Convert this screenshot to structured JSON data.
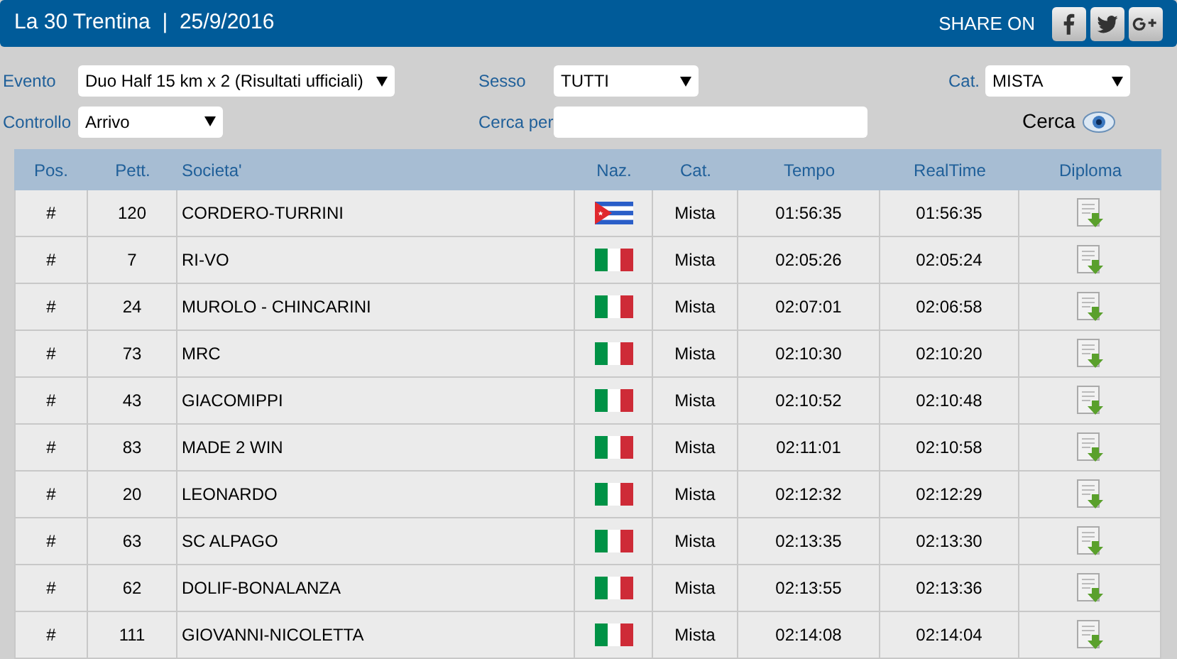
{
  "header": {
    "title": "La 30 Trentina  |  25/9/2016",
    "share_label": "SHARE ON",
    "share_buttons": [
      {
        "kind": "facebook"
      },
      {
        "kind": "twitter"
      },
      {
        "kind": "googleplus"
      }
    ]
  },
  "filters": {
    "evento": {
      "label": "Evento",
      "value": "Duo Half 15 km x 2 (Risultati ufficiali)"
    },
    "sesso": {
      "label": "Sesso",
      "value": "TUTTI"
    },
    "cat": {
      "label": "Cat.",
      "value": "MISTA"
    },
    "controllo": {
      "label": "Controllo",
      "value": "Arrivo"
    },
    "cerca_per": {
      "label": "Cerca per"
    },
    "search_button": "Cerca"
  },
  "table": {
    "columns": [
      "Pos.",
      "Pett.",
      "Societa'",
      "Naz.",
      "Cat.",
      "Tempo",
      "RealTime",
      "Diploma"
    ],
    "rows": [
      {
        "pos": "#",
        "pett": "120",
        "societa": "CORDERO-TURRINI",
        "naz": {
          "kind": "cuba"
        },
        "cat": "Mista",
        "tempo": "01:56:35",
        "realtime": "01:56:35"
      },
      {
        "pos": "#",
        "pett": "7",
        "societa": "RI-VO",
        "naz": {
          "kind": "italy"
        },
        "cat": "Mista",
        "tempo": "02:05:26",
        "realtime": "02:05:24"
      },
      {
        "pos": "#",
        "pett": "24",
        "societa": "MUROLO - CHINCARINI",
        "naz": {
          "kind": "italy"
        },
        "cat": "Mista",
        "tempo": "02:07:01",
        "realtime": "02:06:58"
      },
      {
        "pos": "#",
        "pett": "73",
        "societa": "MRC",
        "naz": {
          "kind": "italy"
        },
        "cat": "Mista",
        "tempo": "02:10:30",
        "realtime": "02:10:20"
      },
      {
        "pos": "#",
        "pett": "43",
        "societa": "GIACOMIPPI",
        "naz": {
          "kind": "italy"
        },
        "cat": "Mista",
        "tempo": "02:10:52",
        "realtime": "02:10:48"
      },
      {
        "pos": "#",
        "pett": "83",
        "societa": "MADE 2 WIN",
        "naz": {
          "kind": "italy"
        },
        "cat": "Mista",
        "tempo": "02:11:01",
        "realtime": "02:10:58"
      },
      {
        "pos": "#",
        "pett": "20",
        "societa": "LEONARDO",
        "naz": {
          "kind": "italy"
        },
        "cat": "Mista",
        "tempo": "02:12:32",
        "realtime": "02:12:29"
      },
      {
        "pos": "#",
        "pett": "63",
        "societa": "SC ALPAGO",
        "naz": {
          "kind": "italy"
        },
        "cat": "Mista",
        "tempo": "02:13:35",
        "realtime": "02:13:30"
      },
      {
        "pos": "#",
        "pett": "62",
        "societa": "DOLIF-BONALANZA",
        "naz": {
          "kind": "italy"
        },
        "cat": "Mista",
        "tempo": "02:13:55",
        "realtime": "02:13:36"
      },
      {
        "pos": "#",
        "pett": "111",
        "societa": "GIOVANNI-NICOLETTA",
        "naz": {
          "kind": "italy"
        },
        "cat": "Mista",
        "tempo": "02:14:08",
        "realtime": "02:14:04"
      }
    ]
  }
}
